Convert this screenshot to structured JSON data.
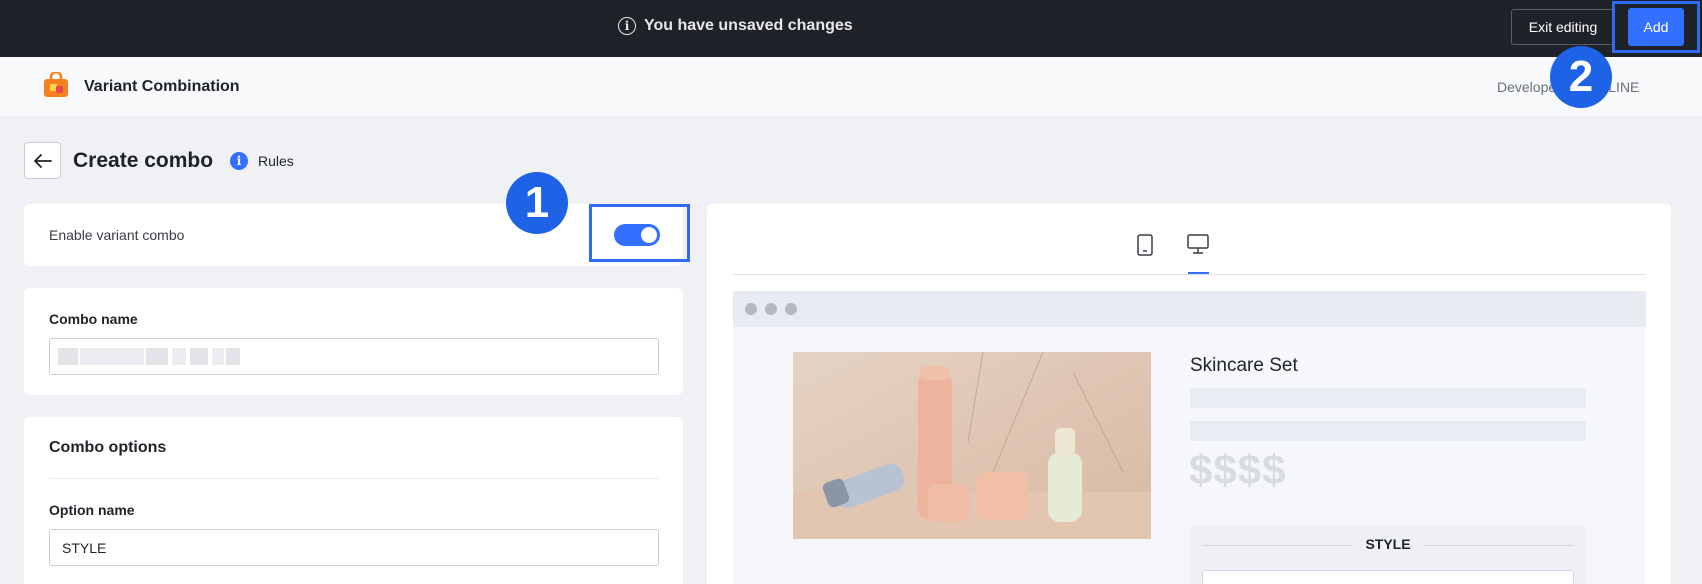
{
  "topbar": {
    "unsaved_text": "You have unsaved changes",
    "exit_label": "Exit editing",
    "add_label": "Add"
  },
  "app": {
    "name": "Variant Combination",
    "developer_text": "Developer: SHOPLINE"
  },
  "page": {
    "title": "Create combo",
    "rules_label": "Rules"
  },
  "enable_card": {
    "label": "Enable variant combo",
    "enabled": true
  },
  "combo_name": {
    "label": "Combo name",
    "value": ""
  },
  "combo_options": {
    "heading": "Combo options",
    "option_label": "Option name",
    "option_value": "STYLE"
  },
  "preview": {
    "active_device": "desktop",
    "product_name": "Skincare Set",
    "price": "$$$$",
    "option_title": "STYLE"
  },
  "markers": {
    "step1": "1",
    "step2": "2"
  },
  "colors": {
    "accent": "#3370ff",
    "marker": "#1e62e6",
    "topbar_bg": "#1f2229"
  }
}
